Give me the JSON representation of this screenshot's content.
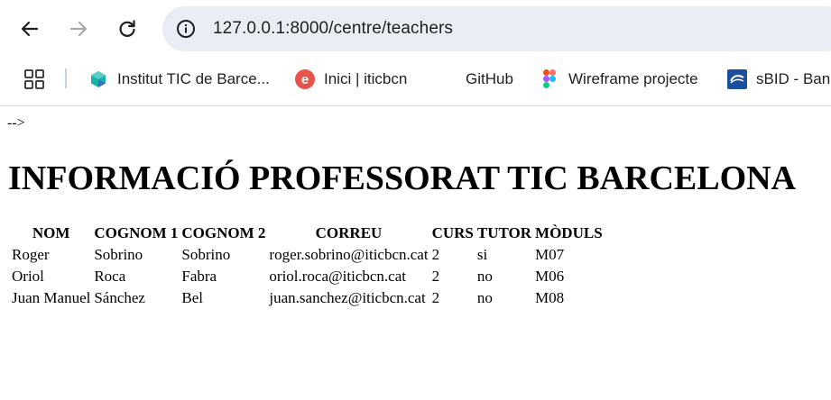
{
  "browser": {
    "url": "127.0.0.1:8000/centre/teachers",
    "bookmarks": [
      {
        "label": "Institut TIC de Barce...",
        "icon": "institut-tic-icon"
      },
      {
        "label": "Inici | iticbcn",
        "icon": "iticbcn-e-icon"
      },
      {
        "label": "GitHub",
        "icon": "github-icon"
      },
      {
        "label": "Wireframe projecte",
        "icon": "figma-icon"
      },
      {
        "label": "sBID - Banc",
        "icon": "sbid-icon"
      }
    ],
    "colors": {
      "omnibox": "#e9eef6",
      "ebook_red": "#e5534b",
      "institut_teal": "#1bb3a9",
      "sbid_blue": "#1b4f9c"
    }
  },
  "page": {
    "stray_text": "-->",
    "title": "INFORMACIÓ PROFESSORAT TIC BARCELONA",
    "table": {
      "headers": [
        "NOM",
        "COGNOM 1",
        "COGNOM 2",
        "CORREU",
        "CURS",
        "TUTOR",
        "MÒDULS"
      ],
      "rows": [
        [
          "Roger",
          "Sobrino",
          "Sobrino",
          "roger.sobrino@iticbcn.cat",
          "2",
          "si",
          "M07"
        ],
        [
          "Oriol",
          "Roca",
          "Fabra",
          "oriol.roca@iticbcn.cat",
          "2",
          "no",
          "M06"
        ],
        [
          "Juan Manuel",
          "Sánchez",
          "Bel",
          "juan.sanchez@iticbcn.cat",
          "2",
          "no",
          "M08"
        ]
      ]
    }
  }
}
